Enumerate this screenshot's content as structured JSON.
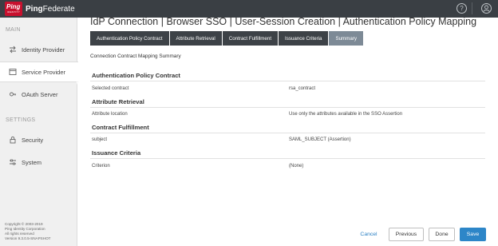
{
  "brand": {
    "mark_text": "Ping",
    "mark_subtext": "IDENTITY",
    "name_bold": "Ping",
    "name_regular": "Federate"
  },
  "header": {
    "help_icon": "?",
    "user_icon": "person-icon"
  },
  "sidebar": {
    "main_heading": "MAIN",
    "settings_heading": "SETTINGS",
    "items": [
      {
        "label": "Identity Provider",
        "icon": "swap-icon"
      },
      {
        "label": "Service Provider",
        "icon": "window-icon"
      },
      {
        "label": "OAuth Server",
        "icon": "key-icon"
      },
      {
        "label": "Security",
        "icon": "lock-icon"
      },
      {
        "label": "System",
        "icon": "sliders-icon"
      }
    ],
    "copyright": [
      "Copyright © 2003-2019",
      "Ping Identity Corporation",
      "All rights reserved",
      "Version 9.3.0.5-SNAPSHOT"
    ]
  },
  "page": {
    "title": "IdP Connection | Browser SSO | User-Session Creation | Authentication Policy Mapping",
    "subtitle": "Connection Contract Mapping Summary"
  },
  "tabs": [
    {
      "label": "Authentication Policy Contract"
    },
    {
      "label": "Attribute Retrieval"
    },
    {
      "label": "Contract Fulfillment"
    },
    {
      "label": "Issuance Criteria"
    },
    {
      "label": "Summary"
    }
  ],
  "summary": [
    {
      "title": "Authentication Policy Contract",
      "label": "Selected contract",
      "value": "rsa_contract"
    },
    {
      "title": "Attribute Retrieval",
      "label": "Attribute location",
      "value": "Use only the attributes available in the SSO Assertion"
    },
    {
      "title": "Contract Fulfillment",
      "label": "subject",
      "value": "SAML_SUBJECT (Assertion)"
    },
    {
      "title": "Issuance Criteria",
      "label": "Criterion",
      "value": "(None)"
    }
  ],
  "buttons": {
    "cancel": "Cancel",
    "previous": "Previous",
    "done": "Done",
    "save": "Save"
  },
  "colors": {
    "topbar": "#3a3f44",
    "brand_red": "#c8102e",
    "tab_dark": "#3d4247",
    "tab_current": "#7d8a96",
    "accent_blue": "#2d86c8"
  }
}
